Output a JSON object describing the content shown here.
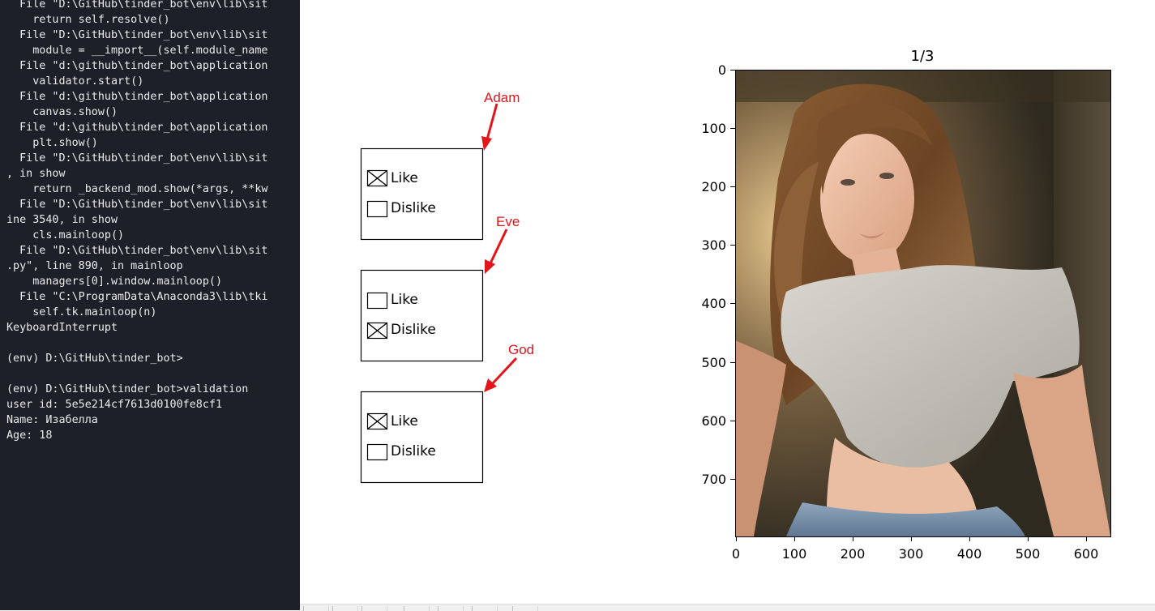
{
  "terminal": {
    "lines": [
      "  File \"D:\\GitHub\\tinder_bot\\env\\lib\\sit",
      "    return self.resolve()",
      "  File \"D:\\GitHub\\tinder_bot\\env\\lib\\sit",
      "    module = __import__(self.module_name",
      "  File \"d:\\github\\tinder_bot\\application",
      "    validator.start()",
      "  File \"d:\\github\\tinder_bot\\application",
      "    canvas.show()",
      "  File \"d:\\github\\tinder_bot\\application",
      "    plt.show()",
      "  File \"D:\\GitHub\\tinder_bot\\env\\lib\\sit",
      ", in show",
      "    return _backend_mod.show(*args, **kw",
      "  File \"D:\\GitHub\\tinder_bot\\env\\lib\\sit",
      "ine 3540, in show",
      "    cls.mainloop()",
      "  File \"D:\\GitHub\\tinder_bot\\env\\lib\\sit",
      ".py\", line 890, in mainloop",
      "    managers[0].window.mainloop()",
      "  File \"C:\\ProgramData\\Anaconda3\\lib\\tki",
      "    self.tk.mainloop(n)",
      "KeyboardInterrupt",
      "",
      "(env) D:\\GitHub\\tinder_bot>",
      "",
      "(env) D:\\GitHub\\tinder_bot>validation",
      "user id: 5e5e214cf7613d0100fe8cf1",
      "Name: Изабелла",
      "Age: 18"
    ]
  },
  "annotations": {
    "adam": "Adam",
    "eve": "Eve",
    "god": "God",
    "arrow_color": "#e5141b"
  },
  "check_groups": [
    {
      "like_label": "Like",
      "dislike_label": "Dislike",
      "like_checked": true,
      "dislike_checked": false
    },
    {
      "like_label": "Like",
      "dislike_label": "Dislike",
      "like_checked": false,
      "dislike_checked": true
    },
    {
      "like_label": "Like",
      "dislike_label": "Dislike",
      "like_checked": true,
      "dislike_checked": false
    }
  ],
  "image_axes": {
    "title": "1/3",
    "y_ticks": [
      "0",
      "100",
      "200",
      "300",
      "400",
      "500",
      "600",
      "700"
    ],
    "x_ticks": [
      "0",
      "100",
      "200",
      "300",
      "400",
      "500",
      "600"
    ],
    "image_description_icon": "photo-placeholder"
  }
}
